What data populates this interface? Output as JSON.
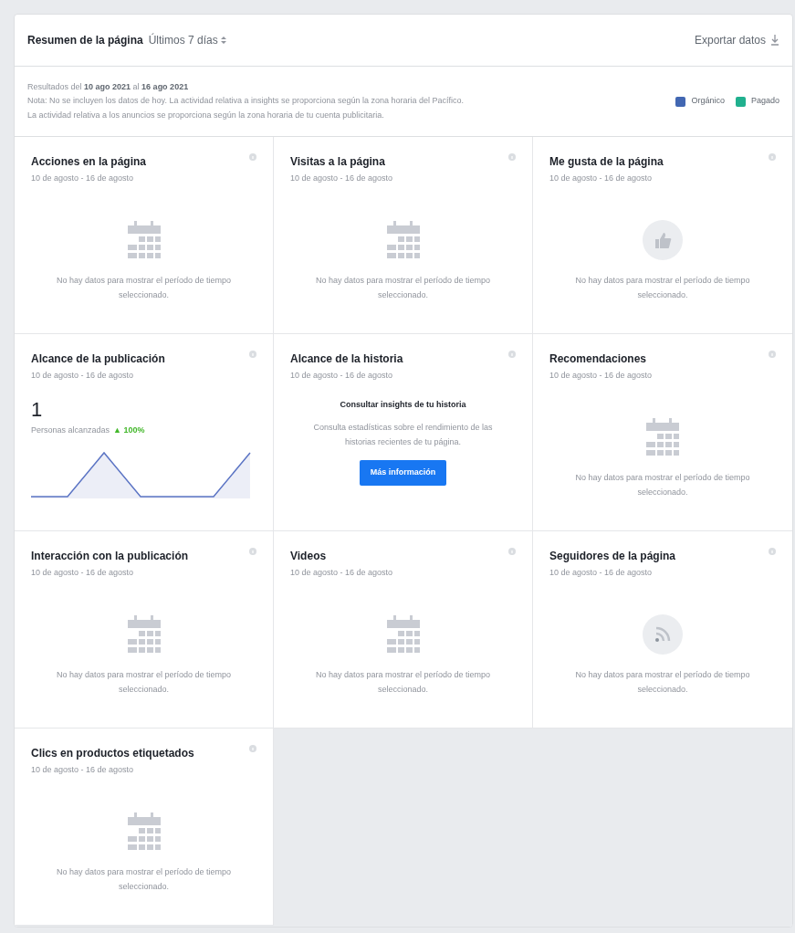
{
  "header": {
    "title": "Resumen de la página",
    "period": "Últimos 7 días",
    "export": "Exportar datos"
  },
  "info": {
    "results": "Resultados del **10 ago 2021** al **16 ago 2021**",
    "notes": [
      "Nota: No se incluyen los datos de hoy. La actividad relativa a insights se proporciona según la zona horaria del Pacífico.",
      "La actividad relativa a los anuncios se proporciona según la zona horaria de tu cuenta publicitaria."
    ],
    "legend": [
      {
        "label": "Orgánico",
        "color": "#4267b2"
      },
      {
        "label": "Pagado",
        "color": "#20b08e"
      }
    ]
  },
  "cards": [
    {
      "kind": "calendar",
      "title": "Acciones en la página",
      "dates": "10 de agosto - 16 de agosto",
      "message": "No hay datos para mostrar el período de tiempo seleccionado."
    },
    {
      "kind": "calendar",
      "title": "Visitas a la página",
      "dates": "10 de agosto - 16 de agosto",
      "message": "No hay datos para mostrar el período de tiempo seleccionado."
    },
    {
      "kind": "like",
      "title": "Me gusta de la página",
      "dates": "10 de agosto - 16 de agosto",
      "message": "No hay datos para mostrar el período de tiempo seleccionado."
    },
    {
      "kind": "metric",
      "title": "Alcance de la publicación",
      "dates": "10 de agosto - 16 de agosto",
      "value": "1",
      "label": "Personas alcanzadas",
      "change": "▲ 100%"
    },
    {
      "kind": "story",
      "title": "Alcance de la historia",
      "dates": "10 de agosto - 16 de agosto",
      "heading": "Consultar insights de tu historia",
      "text": "Consulta estadísticas sobre el rendimiento de las historias recientes de tu página.",
      "button": "Más información"
    },
    {
      "kind": "calendar",
      "title": "Recomendaciones",
      "dates": "10 de agosto - 16 de agosto",
      "message": "No hay datos para mostrar el período de tiempo seleccionado."
    },
    {
      "kind": "calendar",
      "title": "Interacción con la publicación",
      "dates": "10 de agosto - 16 de agosto",
      "message": "No hay datos para mostrar el período de tiempo seleccionado."
    },
    {
      "kind": "calendar",
      "title": "Videos",
      "dates": "10 de agosto - 16 de agosto",
      "message": "No hay datos para mostrar el período de tiempo seleccionado."
    },
    {
      "kind": "feed",
      "title": "Seguidores de la página",
      "dates": "10 de agosto - 16 de agosto",
      "message": "No hay datos para mostrar el período de tiempo seleccionado."
    },
    {
      "kind": "calendar",
      "title": "Clics en productos etiquetados",
      "dates": "10 de agosto - 16 de agosto",
      "message": "No hay datos para mostrar el período de tiempo seleccionado."
    }
  ]
}
